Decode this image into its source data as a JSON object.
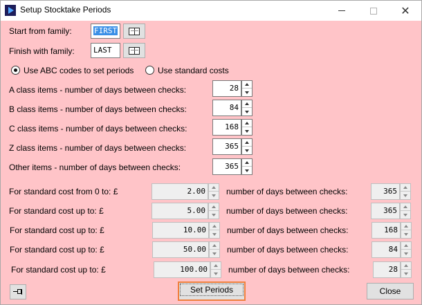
{
  "window": {
    "title": "Setup Stocktake Periods",
    "close_glyph": "✕"
  },
  "family": {
    "start_label": "Start from family:",
    "start_value": "FIRST",
    "finish_label": "Finish with family:",
    "finish_value": "LAST"
  },
  "mode": {
    "abc_label": "Use ABC codes to set periods",
    "abc_selected": true,
    "standard_label": "Use standard costs",
    "standard_selected": false
  },
  "abc": [
    {
      "label": "A class items - number of days between checks:",
      "value": "28"
    },
    {
      "label": "B class items - number of days between checks:",
      "value": "84"
    },
    {
      "label": "C class items - number of days between checks:",
      "value": "168"
    },
    {
      "label": "Z class items - number of days between checks:",
      "value": "365"
    },
    {
      "label": "Other items - number of days between checks:",
      "value": "365"
    }
  ],
  "cost": {
    "days_label": "number of days between checks:",
    "rows": [
      {
        "label": "For standard cost from 0 to: £",
        "cost": "2.00",
        "days": "365"
      },
      {
        "label": "For standard cost up to: £",
        "cost": "5.00",
        "days": "365"
      },
      {
        "label": "For standard cost up to: £",
        "cost": "10.00",
        "days": "168"
      },
      {
        "label": "For standard cost up to: £",
        "cost": "50.00",
        "days": "84"
      },
      {
        "label": "For standard cost up to: £",
        "cost": "100.00",
        "days": "28"
      }
    ]
  },
  "buttons": {
    "set_periods": "Set Periods",
    "close": "Close"
  },
  "colors": {
    "dialog_background": "#ffc4c8",
    "focus_border": "#f07f3c",
    "selection": "#3a8fe6"
  },
  "icons": {
    "app": "app-icon",
    "lookup": "book-icon",
    "pin": "pin-icon"
  }
}
